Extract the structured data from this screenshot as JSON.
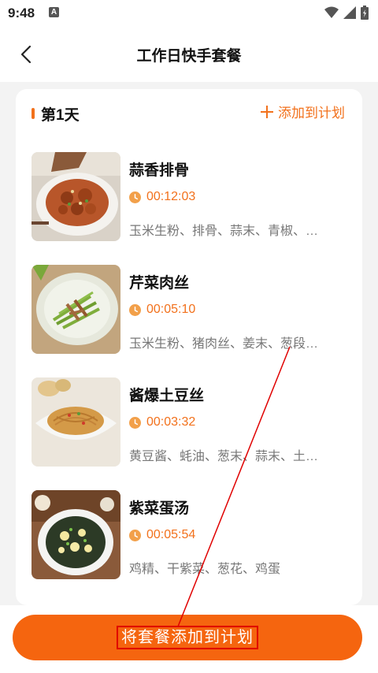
{
  "status_bar": {
    "time": "9:48",
    "a_icon_label": "A",
    "icons": [
      "wifi-icon",
      "signal-icon",
      "battery-icon"
    ]
  },
  "header": {
    "title": "工作日快手套餐",
    "back_icon": "chevron-left-icon"
  },
  "day": {
    "label": "第1天",
    "add_link": "添加到计划"
  },
  "recipes": [
    {
      "name": "蒜香排骨",
      "time": "00:12:03",
      "ingredients": "玉米生粉、排骨、蒜末、青椒、…"
    },
    {
      "name": "芹菜肉丝",
      "time": "00:05:10",
      "ingredients": "玉米生粉、猪肉丝、姜末、葱段…"
    },
    {
      "name": "酱爆土豆丝",
      "time": "00:03:32",
      "ingredients": "黄豆酱、蚝油、葱末、蒜末、土…"
    },
    {
      "name": "紫菜蛋汤",
      "time": "00:05:54",
      "ingredients": "鸡精、干紫菜、葱花、鸡蛋"
    }
  ],
  "bottom": {
    "button_label": "将套餐添加到计划"
  },
  "colors": {
    "accent": "#f2711c",
    "button": "#f5650f",
    "annotation": "#e00000"
  }
}
